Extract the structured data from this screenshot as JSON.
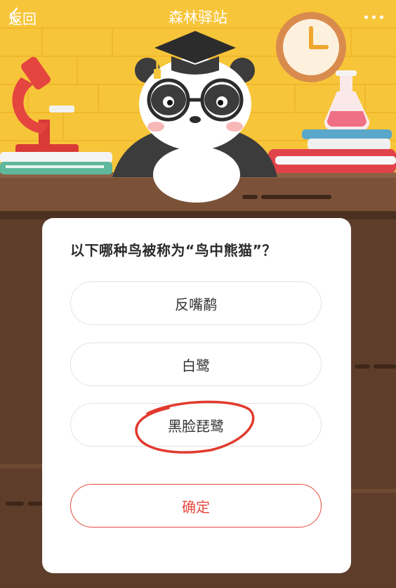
{
  "header": {
    "back_label": "返回",
    "title": "森林驿站"
  },
  "quiz": {
    "question": "以下哪种鸟被称为“鸟中熊猫”？",
    "options": [
      {
        "label": "反嘴鹬"
      },
      {
        "label": "白鹭"
      },
      {
        "label": "黑脸琵鹭"
      }
    ],
    "confirm_label": "确定"
  },
  "colors": {
    "hero_background": "#f7c539",
    "board": "#5e3e2b",
    "accent": "#e44a3f"
  }
}
